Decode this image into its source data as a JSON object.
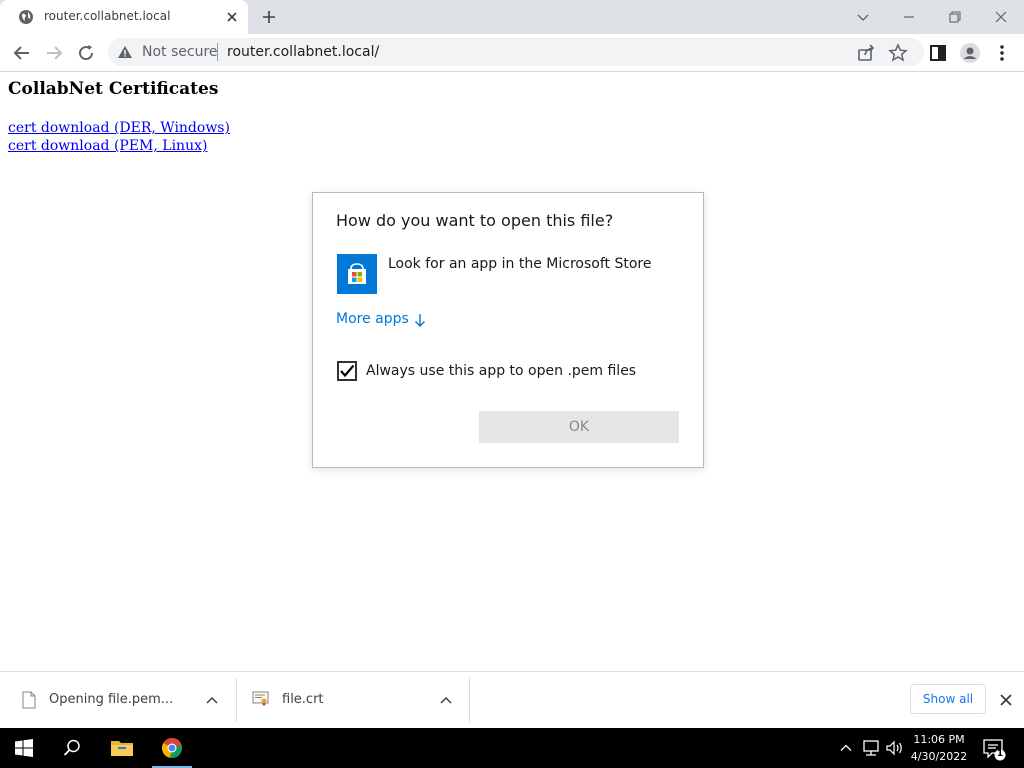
{
  "browser": {
    "tab": {
      "title": "router.collabnet.local",
      "favicon": "globe-icon"
    },
    "new_tab_icon": "plus-icon",
    "window_controls": [
      "chevron-down-icon",
      "minimize-icon",
      "restore-icon",
      "close-icon"
    ],
    "toolbar": {
      "back_icon": "back-arrow-icon",
      "forward_icon": "forward-arrow-icon",
      "reload_icon": "reload-icon",
      "security_label": "Not secure",
      "url": "router.collabnet.local/",
      "share_icon": "share-icon",
      "bookmark_icon": "star-icon",
      "side_panel_icon": "side-panel-icon",
      "profile_icon": "profile-icon",
      "menu_icon": "kebab-menu-icon"
    }
  },
  "page": {
    "heading": "CollabNet Certificates",
    "links": [
      "cert download (DER, Windows)",
      "cert download (PEM, Linux)"
    ]
  },
  "dialog": {
    "title": "How do you want to open this file?",
    "store_option": "Look for an app in the Microsoft Store",
    "more_apps": "More apps",
    "always_use_label": "Always use this app to open .pem files",
    "always_use_checked": true,
    "ok_label": "OK"
  },
  "downloads": {
    "items": [
      {
        "name": "Opening file.pem...",
        "icon": "file-icon"
      },
      {
        "name": "file.crt",
        "icon": "certificate-icon"
      }
    ],
    "show_all_label": "Show all"
  },
  "taskbar": {
    "icons": [
      "windows-start-icon",
      "search-icon",
      "file-explorer-icon",
      "chrome-icon"
    ],
    "time": "11:06 PM",
    "date": "4/30/2022",
    "notification_count": "1"
  },
  "colors": {
    "accent": "#0078d7",
    "link": "#0000ee",
    "tabstrip": "#dee1e6"
  }
}
